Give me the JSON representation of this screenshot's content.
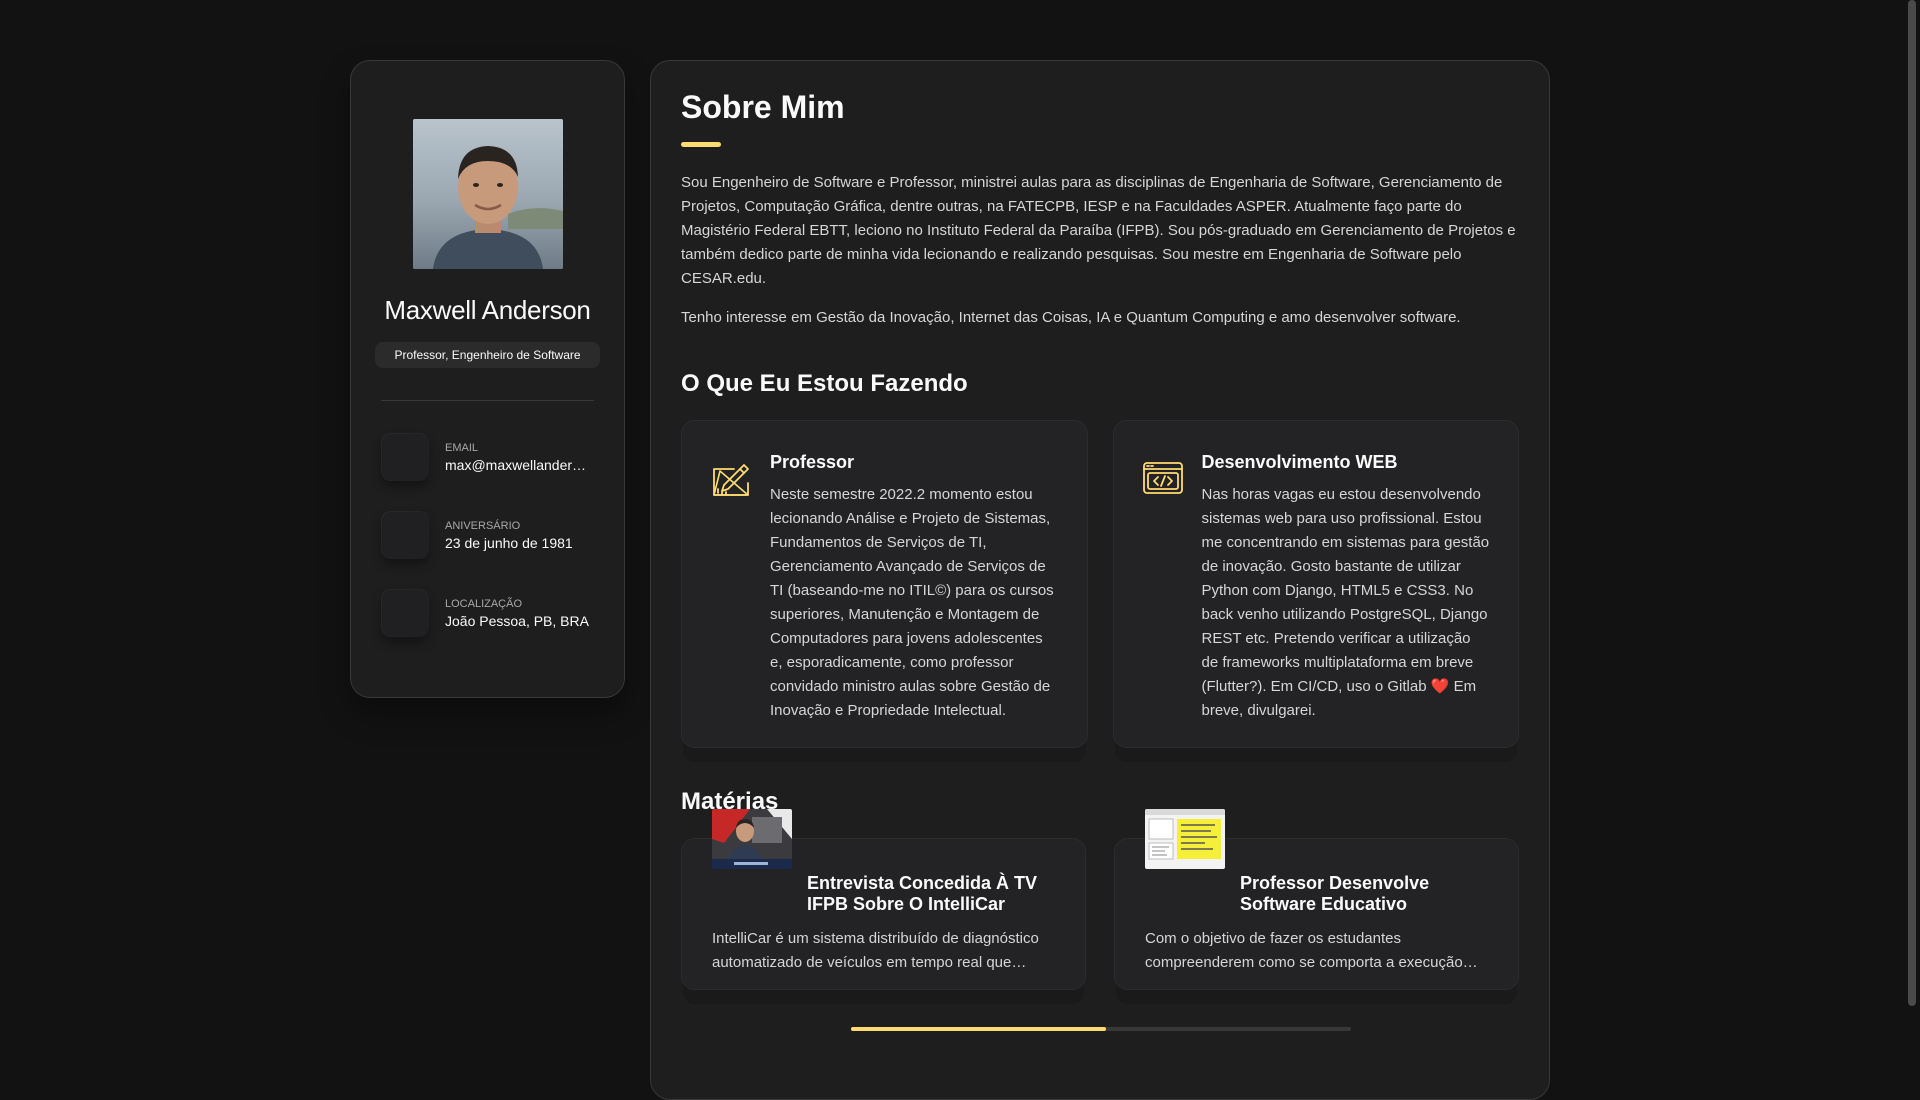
{
  "sidebar": {
    "name": "Maxwell Anderson",
    "title": "Professor, Engenheiro de Software",
    "contacts": [
      {
        "label": "EMAIL",
        "value": "max@maxwellanderson.com.br",
        "icon": "mail-icon"
      },
      {
        "label": "ANIVERSÁRIO",
        "value": "23 de junho de 1981",
        "icon": "calendar-icon"
      },
      {
        "label": "LOCALIZAÇÃO",
        "value": "João Pessoa, PB, BRA",
        "icon": "location-icon"
      }
    ]
  },
  "about": {
    "title": "Sobre Mim",
    "paragraph1": "Sou Engenheiro de Software e Professor, ministrei aulas para as disciplinas de Engenharia de Software, Gerenciamento de Projetos, Computação Gráfica, dentre outras, na FATECPB, IESP e na Faculdades ASPER. Atualmente faço parte do Magistério Federal EBTT, leciono no Instituto Federal da Paraíba (IFPB). Sou pós-graduado em Gerenciamento de Projetos e também dedico parte de minha vida lecionando e realizando pesquisas. Sou mestre em Engenharia de Software pelo CESAR.edu.",
    "paragraph2": "Tenho interesse em Gestão da Inovação, Internet das Coisas, IA e Quantum Computing e amo desenvolver software."
  },
  "services": {
    "title": "O Que Eu Estou Fazendo",
    "items": [
      {
        "title": "Professor",
        "text": "Neste semestre 2022.2 momento estou lecionando Análise e Projeto de Sistemas, Fundamentos de Serviços de TI, Gerenciamento Avançado de Serviços de TI (baseando-me no ITIL©) para os cursos superiores, Manutenção e Montagem de Computadores para jovens adolescentes e, esporadicamente, como professor convidado ministro aulas sobre Gestão de Inovação e Propriedade Intelectual.",
        "icon": "design-pencil-icon"
      },
      {
        "title": "Desenvolvimento WEB",
        "text": "Nas horas vagas eu estou desenvolvendo sistemas web para uso profissional. Estou me concentrando em sistemas para gestão de inovação. Gosto bastante de utilizar Python com Django, HTML5 e CSS3. No back venho utilizando PostgreSQL, Django REST etc. Pretendo verificar a utilização de frameworks multiplataforma em breve (Flutter?). Em CI/CD, uso o Gitlab ❤️ Em breve, divulgarei.",
        "icon": "code-window-icon"
      }
    ]
  },
  "materias": {
    "title": "Matérias",
    "items": [
      {
        "title": "Entrevista Concedida À TV IFPB Sobre O IntelliCar",
        "text": "IntelliCar é um sistema distribuído de diagnóstico automatizado de veículos em tempo real que permite o monitoramento remoto",
        "thumb": "interview-thumbnail"
      },
      {
        "title": "Professor Desenvolve Software Educativo",
        "text": "Com o objetivo de fazer os estudantes compreenderem como se comporta a execução dos algoritmos de escalonamento",
        "thumb": "software-thumbnail"
      }
    ],
    "progress": 0.51
  },
  "colors": {
    "accent": "#ffdb70",
    "background": "#121212",
    "card": "#1e1e1f"
  }
}
